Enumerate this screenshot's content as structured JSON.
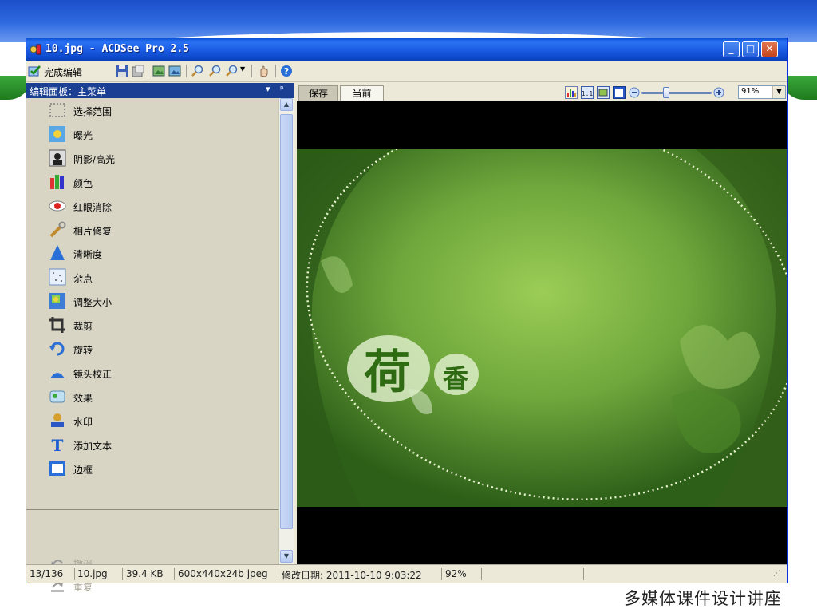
{
  "footer": {
    "text": "多媒体课件设计讲座"
  },
  "window": {
    "title": "10.jpg - ACDSee Pro 2.5",
    "buttons": {
      "minimize": "_",
      "maximize": "□",
      "close": "✕"
    }
  },
  "toolbar": {
    "done_label": "完成编辑"
  },
  "panel": {
    "title": "编辑面板：主菜单",
    "dropdown": "▾",
    "pin": "ᵖ",
    "items": [
      {
        "label": "选择范围",
        "icon": "selection-icon"
      },
      {
        "label": "曝光",
        "icon": "exposure-icon"
      },
      {
        "label": "阴影/高光",
        "icon": "shadow-highlight-icon"
      },
      {
        "label": "颜色",
        "icon": "color-icon"
      },
      {
        "label": "红眼消除",
        "icon": "red-eye-icon"
      },
      {
        "label": "相片修复",
        "icon": "photo-repair-icon"
      },
      {
        "label": "清晰度",
        "icon": "sharpness-icon"
      },
      {
        "label": "杂点",
        "icon": "noise-icon"
      },
      {
        "label": "调整大小",
        "icon": "resize-icon"
      },
      {
        "label": "裁剪",
        "icon": "crop-icon"
      },
      {
        "label": "旋转",
        "icon": "rotate-icon"
      },
      {
        "label": "镜头校正",
        "icon": "lens-correction-icon"
      },
      {
        "label": "效果",
        "icon": "effects-icon"
      },
      {
        "label": "水印",
        "icon": "watermark-icon"
      },
      {
        "label": "添加文本",
        "icon": "add-text-icon"
      },
      {
        "label": "边框",
        "icon": "border-icon"
      }
    ],
    "undo_label": "撤消",
    "redo_label": "重复"
  },
  "viewer": {
    "tab_save": "保存",
    "tab_current": "当前",
    "zoom_value": "91%",
    "zoom_level": 0.35,
    "image_title_main": "荷",
    "image_title_sub": "香"
  },
  "status": {
    "index": "13/136",
    "filename": "10.jpg",
    "filesize": "39.4 KB",
    "dimensions": "600x440x24b jpeg",
    "modified": "修改日期: 2011-10-10 9:03:22",
    "zoom": "92%"
  },
  "colors": {
    "title_bar": "#1c5ee6",
    "panel_header": "#1a3f93",
    "panel_bg": "#d8d5c5",
    "image_green": "#6aa23a"
  }
}
